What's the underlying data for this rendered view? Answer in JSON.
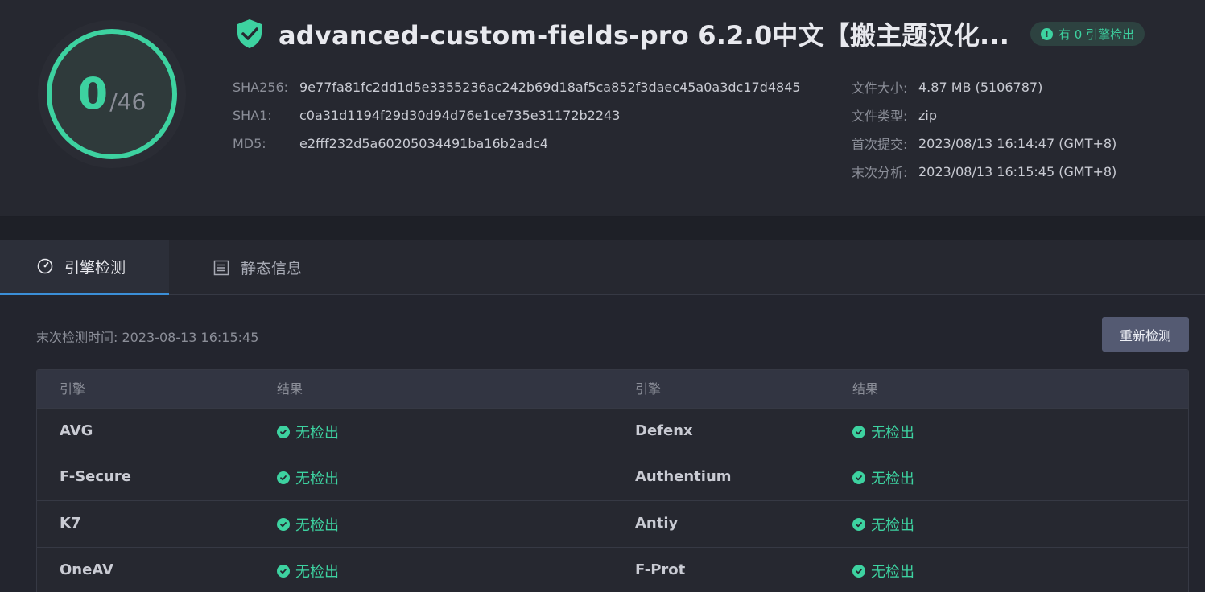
{
  "score": {
    "detected": "0",
    "total": "/46",
    "ring_color": "#3dd2a0",
    "detected_fraction": 0
  },
  "file": {
    "title": "advanced-custom-fields-pro 6.2.0中文【搬主题汉化...",
    "badge": "有 0 引擎检出",
    "hashes": [
      {
        "label": "SHA256:",
        "value": "9e77fa81fc2dd1d5e3355236ac242b69d18af5ca852f3daec45a0a3dc17d4845"
      },
      {
        "label": "SHA1:",
        "value": "c0a31d1194f29d30d94d76e1ce735e31172b2243"
      },
      {
        "label": "MD5:",
        "value": "e2fff232d5a60205034491ba16b2adc4"
      }
    ],
    "meta": [
      {
        "label": "文件大小:",
        "value": "4.87 MB (5106787)"
      },
      {
        "label": "文件类型:",
        "value": "zip"
      },
      {
        "label": "首次提交:",
        "value": "2023/08/13 16:14:47 (GMT+8)"
      },
      {
        "label": "末次分析:",
        "value": "2023/08/13 16:15:45 (GMT+8)"
      }
    ]
  },
  "tabs": [
    {
      "label": "引擎检测",
      "icon": "gauge-icon",
      "active": true
    },
    {
      "label": "静态信息",
      "icon": "list-icon",
      "active": false
    }
  ],
  "detection": {
    "last_check": "末次检测时间: 2023-08-13 16:15:45",
    "rescan_label": "重新检测",
    "headers": {
      "engine": "引擎",
      "result": "结果"
    },
    "rows": [
      {
        "left": {
          "engine": "AVG",
          "result": "无检出"
        },
        "right": {
          "engine": "Defenx",
          "result": "无检出"
        }
      },
      {
        "left": {
          "engine": "F-Secure",
          "result": "无检出"
        },
        "right": {
          "engine": "Authentium",
          "result": "无检出"
        }
      },
      {
        "left": {
          "engine": "K7",
          "result": "无检出"
        },
        "right": {
          "engine": "Antiy",
          "result": "无检出"
        }
      },
      {
        "left": {
          "engine": "OneAV",
          "result": "无检出"
        },
        "right": {
          "engine": "F-Prot",
          "result": "无检出"
        }
      }
    ]
  },
  "colors": {
    "accent": "#3dd2a0",
    "tab_indicator": "#3b8fd8",
    "background": "#23252e"
  }
}
